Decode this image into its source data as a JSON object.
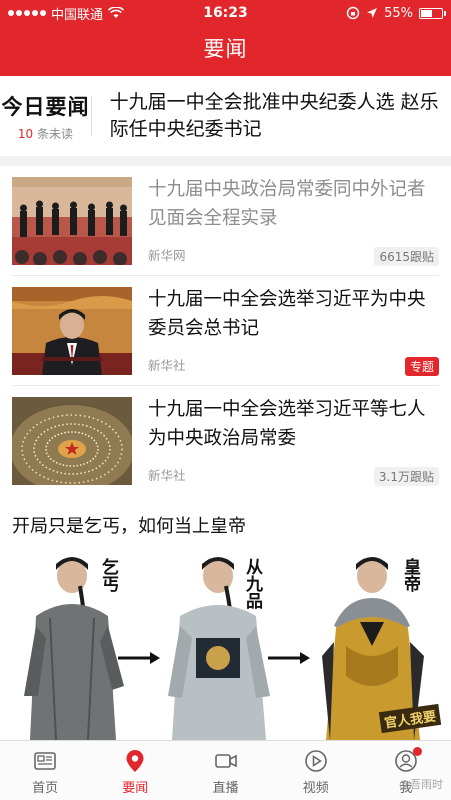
{
  "status": {
    "carrier": "中国联通",
    "time": "16:23",
    "battery": "55%",
    "battery_level": 0.55
  },
  "header": {
    "title": "要闻"
  },
  "today": {
    "title": "今日要闻",
    "unread_count": "10",
    "unread_suffix": "条未读",
    "headline": "十九届一中全会批准中央纪委人选 赵乐际任中央纪委书记"
  },
  "news": [
    {
      "title": "十九届中央政治局常委同中外记者见面会全程实录",
      "source": "新华网",
      "tag": "6615跟贴",
      "read": true
    },
    {
      "title": "十九届一中全会选举习近平为中央委员会总书记",
      "source": "新华社",
      "tag": "专题",
      "read": false
    },
    {
      "title": "十九届一中全会选举习近平等七人为中央政治局常委",
      "source": "新华社",
      "tag": "3.1万跟贴",
      "read": false
    }
  ],
  "ad": {
    "title": "开局只是乞丐，如何当上皇帝",
    "captions": [
      "乞丐",
      "从九品",
      "皇帝"
    ],
    "logo": "官人我要"
  },
  "tabs": [
    {
      "label": "首页",
      "icon": "newspaper-icon"
    },
    {
      "label": "要闻",
      "icon": "location-pin-icon",
      "active": true
    },
    {
      "label": "直播",
      "icon": "video-camera-icon"
    },
    {
      "label": "视频",
      "icon": "play-circle-icon"
    },
    {
      "label": "我",
      "icon": "user-icon",
      "has_dot": true
    }
  ],
  "watermark": "@吾雨时",
  "colors": {
    "accent": "#e2272c"
  }
}
